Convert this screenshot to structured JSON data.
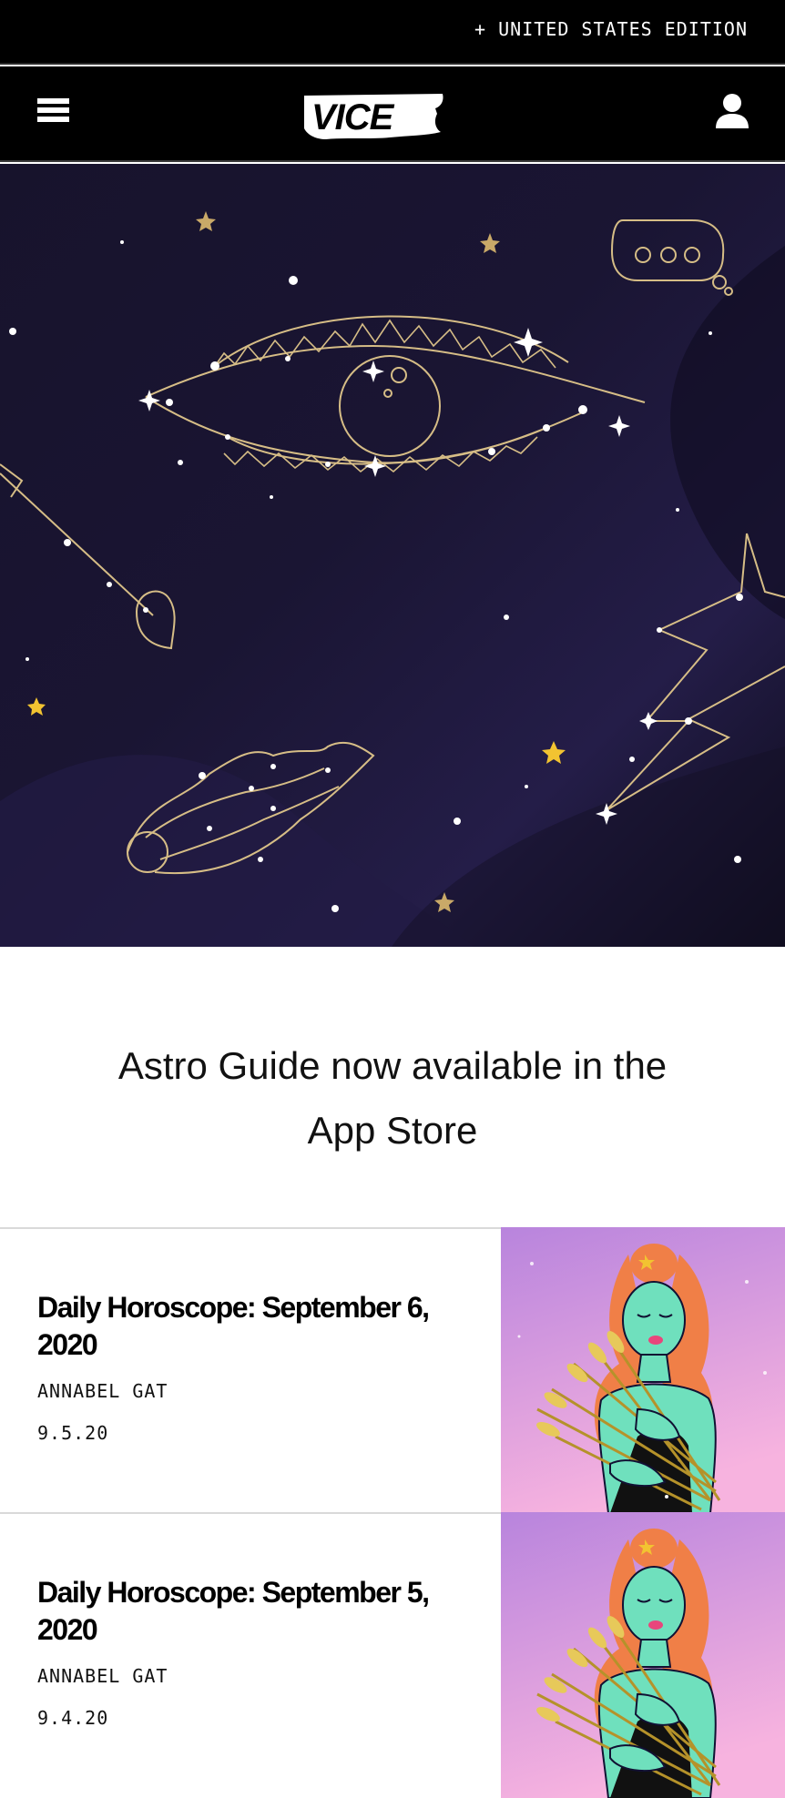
{
  "edition_bar": {
    "label": "+ UNITED STATES EDITION"
  },
  "nav": {
    "logo": "VICE"
  },
  "promo": {
    "text": "Astro Guide now available in the App Store"
  },
  "articles": [
    {
      "title": "Daily Horoscope: September 6, 2020",
      "author": "ANNABEL GAT",
      "date": "9.5.20"
    },
    {
      "title": "Daily Horoscope: September 5, 2020",
      "author": "ANNABEL GAT",
      "date": "9.4.20"
    }
  ],
  "colors": {
    "nav_bg": "#000000",
    "hero_bg": "#1b1635",
    "line_gold": "#d6bd86",
    "star_gold": "#f2c331",
    "thumb_bg": "#d79ad8",
    "figure_skin": "#6fe0bd",
    "figure_hair": "#f07f47"
  }
}
